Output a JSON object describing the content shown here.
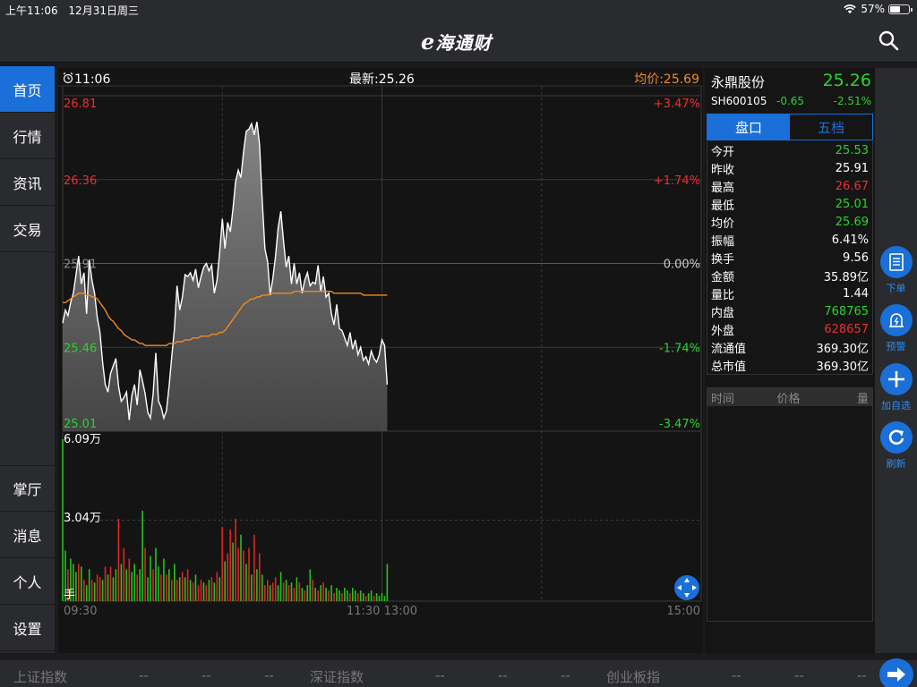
{
  "status_bar": {
    "time": "上午11:06",
    "date": "12月31日周三",
    "battery": "57%",
    "battery_level": 0.57
  },
  "header": {
    "logo_e": "e",
    "logo_text": "海通财",
    "search_icon": "search-icon"
  },
  "sidebar": {
    "items": [
      {
        "label": "首页",
        "active": true
      },
      {
        "label": "行情",
        "active": false
      },
      {
        "label": "资讯",
        "active": false
      },
      {
        "label": "交易",
        "active": false
      },
      {
        "label": "掌厅",
        "active": false
      },
      {
        "label": "消息",
        "active": false
      },
      {
        "label": "个人",
        "active": false
      },
      {
        "label": "设置",
        "active": false
      }
    ]
  },
  "chart_header": {
    "clock_icon": "alarm-clock-icon",
    "time": "11:06",
    "latest": "最新:25.26",
    "avg": "均价:25.69"
  },
  "chart_data": {
    "type": "line",
    "price_axis_left": [
      "26.81",
      "26.36",
      "25.91",
      "25.46",
      "25.01"
    ],
    "price_axis_right": [
      "+3.47%",
      "+1.74%",
      "0.00%",
      "-1.74%",
      "-3.47%"
    ],
    "ylim": [
      25.01,
      26.81
    ],
    "prev_close": 25.91,
    "x_ticks": [
      "09:30",
      "11:30 13:00",
      "15:00"
    ],
    "volume_labels": [
      "6.09万",
      "3.04万",
      "手"
    ],
    "volume_max": 60900,
    "colors": {
      "up": "#e02424",
      "down": "#23c223",
      "price": "#ffffff",
      "avg": "#f08a24",
      "area": "#7a7a7a"
    },
    "series": [
      {
        "name": "price",
        "values": [
          25.59,
          25.66,
          25.63,
          25.7,
          25.75,
          25.85,
          25.95,
          25.8,
          25.86,
          25.64,
          25.93,
          25.82,
          25.75,
          25.62,
          25.54,
          25.38,
          25.26,
          25.22,
          25.32,
          25.36,
          25.4,
          25.25,
          25.17,
          25.19,
          25.22,
          25.07,
          25.2,
          25.26,
          25.15,
          25.34,
          25.28,
          25.21,
          25.11,
          25.08,
          25.21,
          25.43,
          25.17,
          25.14,
          25.08,
          25.12,
          25.25,
          25.41,
          25.56,
          25.79,
          25.66,
          25.73,
          25.85,
          25.84,
          25.86,
          25.82,
          25.88,
          25.78,
          25.84,
          25.89,
          25.91,
          25.87,
          25.9,
          25.75,
          25.82,
          25.97,
          26.15,
          25.99,
          26.13,
          26.08,
          26.2,
          26.35,
          26.41,
          26.37,
          26.51,
          26.62,
          26.63,
          26.66,
          26.6,
          26.67,
          26.55,
          26.25,
          25.99,
          25.92,
          25.74,
          25.83,
          25.95,
          26.1,
          26.19,
          26.03,
          25.89,
          25.95,
          25.8,
          25.91,
          25.8,
          25.86,
          25.75,
          25.82,
          25.86,
          25.79,
          25.81,
          25.8,
          25.9,
          25.76,
          25.84,
          25.73,
          25.75,
          25.64,
          25.58,
          25.69,
          25.56,
          25.55,
          25.51,
          25.47,
          25.54,
          25.45,
          25.5,
          25.42,
          25.46,
          25.39,
          25.41,
          25.37,
          25.44,
          25.4,
          25.38,
          25.42,
          25.5,
          25.47,
          25.26
        ]
      },
      {
        "name": "avg",
        "values": [
          25.7,
          25.7,
          25.71,
          25.72,
          25.73,
          25.74,
          25.75,
          25.75,
          25.75,
          25.74,
          25.74,
          25.73,
          25.73,
          25.72,
          25.7,
          25.68,
          25.66,
          25.63,
          25.61,
          25.6,
          25.58,
          25.56,
          25.55,
          25.53,
          25.52,
          25.51,
          25.5,
          25.5,
          25.49,
          25.48,
          25.48,
          25.47,
          25.47,
          25.47,
          25.47,
          25.47,
          25.47,
          25.47,
          25.47,
          25.47,
          25.48,
          25.48,
          25.48,
          25.49,
          25.49,
          25.49,
          25.5,
          25.5,
          25.5,
          25.51,
          25.51,
          25.51,
          25.52,
          25.52,
          25.52,
          25.52,
          25.53,
          25.53,
          25.53,
          25.54,
          25.54,
          25.55,
          25.57,
          25.59,
          25.61,
          25.63,
          25.65,
          25.67,
          25.69,
          25.7,
          25.71,
          25.72,
          25.72,
          25.73,
          25.73,
          25.74,
          25.74,
          25.74,
          25.75,
          25.75,
          25.75,
          25.75,
          25.75,
          25.75,
          25.75,
          25.75,
          25.75,
          25.76,
          25.76,
          25.76,
          25.76,
          25.76,
          25.76,
          25.76,
          25.76,
          25.76,
          25.76,
          25.76,
          25.76,
          25.76,
          25.76,
          25.76,
          25.75,
          25.75,
          25.75,
          25.75,
          25.75,
          25.75,
          25.75,
          25.75,
          25.75,
          25.75,
          25.75,
          25.74,
          25.74,
          25.74,
          25.74,
          25.74,
          25.74,
          25.74,
          25.74,
          25.74,
          25.74
        ]
      }
    ],
    "volume": [
      {
        "v": 60900,
        "up": false
      },
      {
        "v": 19000,
        "up": false
      },
      {
        "v": 12000,
        "up": true
      },
      {
        "v": 16000,
        "up": false
      },
      {
        "v": 14000,
        "up": false
      },
      {
        "v": 11000,
        "up": false
      },
      {
        "v": 14000,
        "up": true
      },
      {
        "v": 13000,
        "up": false
      },
      {
        "v": 8000,
        "up": true
      },
      {
        "v": 6000,
        "up": false
      },
      {
        "v": 12000,
        "up": false
      },
      {
        "v": 8000,
        "up": true
      },
      {
        "v": 7000,
        "up": false
      },
      {
        "v": 10000,
        "up": true
      },
      {
        "v": 9000,
        "up": true
      },
      {
        "v": 8000,
        "up": false
      },
      {
        "v": 13000,
        "up": true
      },
      {
        "v": 10000,
        "up": false
      },
      {
        "v": 13000,
        "up": true
      },
      {
        "v": 9000,
        "up": false
      },
      {
        "v": 12000,
        "up": false
      },
      {
        "v": 31000,
        "up": true
      },
      {
        "v": 14000,
        "up": false
      },
      {
        "v": 20000,
        "up": true
      },
      {
        "v": 12000,
        "up": false
      },
      {
        "v": 16000,
        "up": true
      },
      {
        "v": 11000,
        "up": false
      },
      {
        "v": 14000,
        "up": false
      },
      {
        "v": 10000,
        "up": true
      },
      {
        "v": 12000,
        "up": false
      },
      {
        "v": 34000,
        "up": false
      },
      {
        "v": 20000,
        "up": true
      },
      {
        "v": 9000,
        "up": false
      },
      {
        "v": 17000,
        "up": false
      },
      {
        "v": 12000,
        "up": true
      },
      {
        "v": 20000,
        "up": false
      },
      {
        "v": 13000,
        "up": false
      },
      {
        "v": 10000,
        "up": true
      },
      {
        "v": 16000,
        "up": false
      },
      {
        "v": 10000,
        "up": true
      },
      {
        "v": 12000,
        "up": false
      },
      {
        "v": 8000,
        "up": true
      },
      {
        "v": 14000,
        "up": false
      },
      {
        "v": 8000,
        "up": true
      },
      {
        "v": 9000,
        "up": false
      },
      {
        "v": 11000,
        "up": true
      },
      {
        "v": 9000,
        "up": false
      },
      {
        "v": 12000,
        "up": true
      },
      {
        "v": 8000,
        "up": false
      },
      {
        "v": 7000,
        "up": true
      },
      {
        "v": 10000,
        "up": false
      },
      {
        "v": 6000,
        "up": true
      },
      {
        "v": 8000,
        "up": true
      },
      {
        "v": 7000,
        "up": false
      },
      {
        "v": 6000,
        "up": true
      },
      {
        "v": 8000,
        "up": false
      },
      {
        "v": 9000,
        "up": true
      },
      {
        "v": 7000,
        "up": false
      },
      {
        "v": 11000,
        "up": true
      },
      {
        "v": 9000,
        "up": false
      },
      {
        "v": 28000,
        "up": true
      },
      {
        "v": 15000,
        "up": false
      },
      {
        "v": 18000,
        "up": true
      },
      {
        "v": 27000,
        "up": true
      },
      {
        "v": 22000,
        "up": false
      },
      {
        "v": 31000,
        "up": true
      },
      {
        "v": 20000,
        "up": true
      },
      {
        "v": 25000,
        "up": false
      },
      {
        "v": 19000,
        "up": true
      },
      {
        "v": 14000,
        "up": false
      },
      {
        "v": 20000,
        "up": true
      },
      {
        "v": 10000,
        "up": false
      },
      {
        "v": 25000,
        "up": true
      },
      {
        "v": 12000,
        "up": false
      },
      {
        "v": 18000,
        "up": true
      },
      {
        "v": 10000,
        "up": false
      },
      {
        "v": 6000,
        "up": true
      },
      {
        "v": 8000,
        "up": true
      },
      {
        "v": 6000,
        "up": false
      },
      {
        "v": 7000,
        "up": true
      },
      {
        "v": 9000,
        "up": true
      },
      {
        "v": 6000,
        "up": false
      },
      {
        "v": 11000,
        "up": false
      },
      {
        "v": 7000,
        "up": true
      },
      {
        "v": 8000,
        "up": false
      },
      {
        "v": 6000,
        "up": true
      },
      {
        "v": 7000,
        "up": false
      },
      {
        "v": 5000,
        "up": true
      },
      {
        "v": 9000,
        "up": false
      },
      {
        "v": 7000,
        "up": true
      },
      {
        "v": 5000,
        "up": false
      },
      {
        "v": 4000,
        "up": true
      },
      {
        "v": 6000,
        "up": false
      },
      {
        "v": 12000,
        "up": false
      },
      {
        "v": 8000,
        "up": true
      },
      {
        "v": 5000,
        "up": false
      },
      {
        "v": 4000,
        "up": true
      },
      {
        "v": 6000,
        "up": false
      },
      {
        "v": 7000,
        "up": true
      },
      {
        "v": 5000,
        "up": false
      },
      {
        "v": 4000,
        "up": true
      },
      {
        "v": 6000,
        "up": false
      },
      {
        "v": 3000,
        "up": true
      },
      {
        "v": 5000,
        "up": false
      },
      {
        "v": 4000,
        "up": false
      },
      {
        "v": 3000,
        "up": true
      },
      {
        "v": 5000,
        "up": false
      },
      {
        "v": 4000,
        "up": false
      },
      {
        "v": 3000,
        "up": true
      },
      {
        "v": 5000,
        "up": false
      },
      {
        "v": 4000,
        "up": false
      },
      {
        "v": 3000,
        "up": true
      },
      {
        "v": 4000,
        "up": false
      },
      {
        "v": 3000,
        "up": false
      },
      {
        "v": 2000,
        "up": true
      },
      {
        "v": 3000,
        "up": false
      },
      {
        "v": 4000,
        "up": false
      },
      {
        "v": 2000,
        "up": true
      },
      {
        "v": 3000,
        "up": false
      },
      {
        "v": 2000,
        "up": false
      },
      {
        "v": 3000,
        "up": false
      },
      {
        "v": 2000,
        "up": false
      },
      {
        "v": 14000,
        "up": false
      }
    ],
    "grid": true
  },
  "zoom_icon": "collapse-arrows-icon",
  "quote": {
    "name": "永鼎股份",
    "price": "25.26",
    "code": "SH600105",
    "change": "-0.65",
    "change_pct": "-2.51%",
    "tabs": [
      {
        "label": "盘口",
        "active": true
      },
      {
        "label": "五档",
        "active": false
      }
    ],
    "stats": [
      {
        "label": "今开",
        "value": "25.53",
        "color": "#2bd42b"
      },
      {
        "label": "昨收",
        "value": "25.91",
        "color": "#ffffff"
      },
      {
        "label": "最高",
        "value": "26.67",
        "color": "#e83030"
      },
      {
        "label": "最低",
        "value": "25.01",
        "color": "#2bd42b"
      },
      {
        "label": "均价",
        "value": "25.69",
        "color": "#2bd42b"
      },
      {
        "label": "振幅",
        "value": "6.41%",
        "color": "#ffffff"
      },
      {
        "label": "换手",
        "value": "9.56",
        "color": "#ffffff"
      },
      {
        "label": "金额",
        "value": "35.89亿",
        "color": "#ffffff"
      },
      {
        "label": "量比",
        "value": "1.44",
        "color": "#ffffff"
      },
      {
        "label": "内盘",
        "value": "768765",
        "color": "#2bd42b"
      },
      {
        "label": "外盘",
        "value": "628657",
        "color": "#e83030"
      },
      {
        "label": "流通值",
        "value": "369.30亿",
        "color": "#ffffff"
      },
      {
        "label": "总市值",
        "value": "369.30亿",
        "color": "#ffffff"
      }
    ],
    "trades_head": [
      "时间",
      "价格",
      "量"
    ]
  },
  "actions": [
    {
      "label": "下单",
      "icon": "order-form-icon"
    },
    {
      "label": "预警",
      "icon": "alarm-bell-icon"
    },
    {
      "label": "加自选",
      "icon": "plus-icon"
    },
    {
      "label": "刷新",
      "icon": "refresh-icon"
    }
  ],
  "bottom": {
    "indices": [
      {
        "name": "上证指数",
        "v1": "--",
        "v2": "--",
        "v3": "--"
      },
      {
        "name": "深证指数",
        "v1": "--",
        "v2": "--",
        "v3": "--"
      },
      {
        "name": "创业板指",
        "v1": "--",
        "v2": "--",
        "v3": "--"
      }
    ],
    "arrow_icon": "arrow-right-icon"
  }
}
